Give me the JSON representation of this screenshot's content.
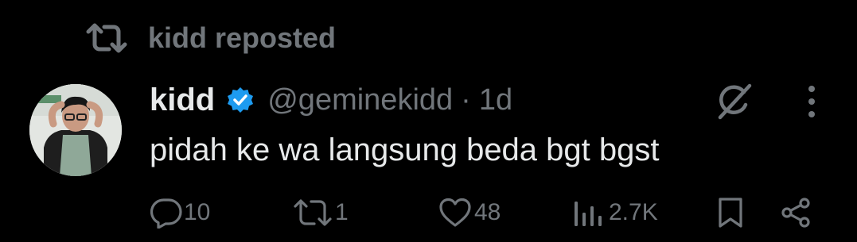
{
  "repost_banner": {
    "icon": "repost-icon",
    "text": "kidd reposted"
  },
  "tweet": {
    "author": {
      "name": "kidd",
      "verified": true,
      "handle": "@geminekidd",
      "avatar": "avatar"
    },
    "separator": "·",
    "timestamp": "1d",
    "text": "pidah ke wa langsung beda bgt bgst",
    "actions": {
      "replies": "10",
      "reposts": "1",
      "likes": "48",
      "views": "2.7K"
    }
  },
  "colors": {
    "background": "#000000",
    "primary_text": "#e7e9ea",
    "secondary_text": "#71767b",
    "verified_blue": "#1d9bf0"
  }
}
